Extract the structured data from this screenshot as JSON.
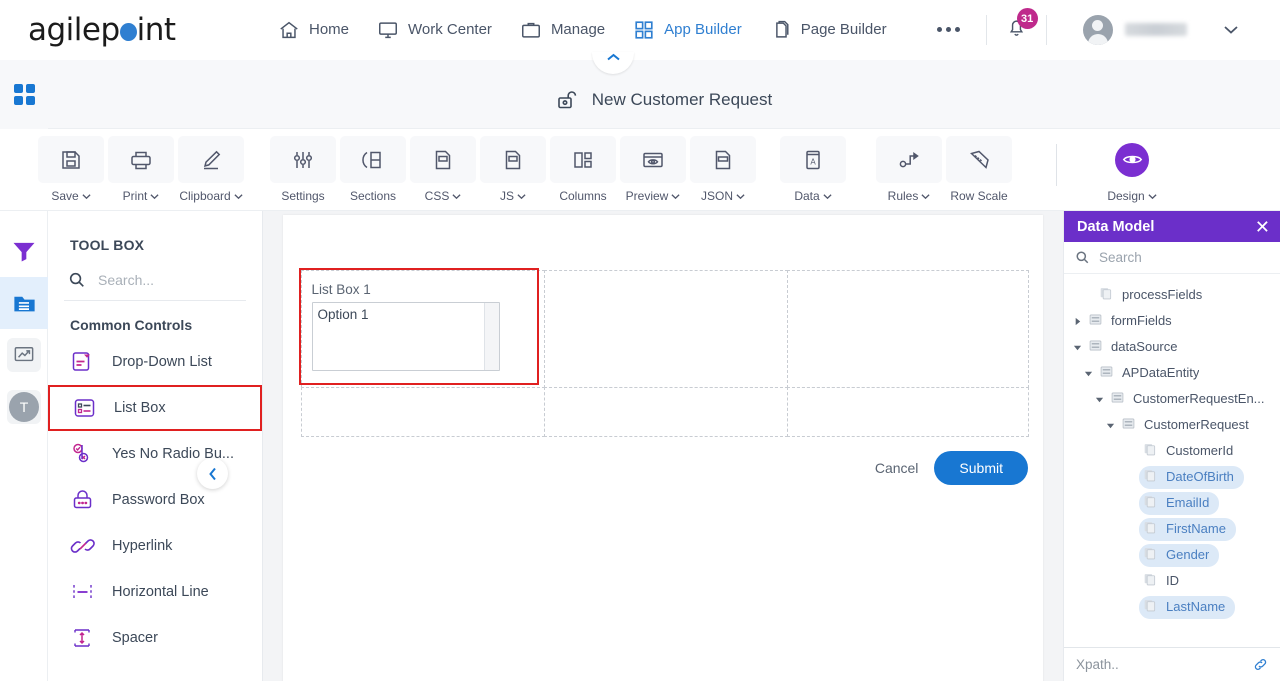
{
  "brand": {
    "name_prefix": "agilep",
    "name_suffix": "int",
    "dot_color": "#2f7fd1"
  },
  "topnav": {
    "items": [
      {
        "label": "Home",
        "icon": "home-icon",
        "active": false
      },
      {
        "label": "Work Center",
        "icon": "monitor-icon",
        "active": false
      },
      {
        "label": "Manage",
        "icon": "briefcase-icon",
        "active": false
      },
      {
        "label": "App Builder",
        "icon": "grid-icon",
        "active": true
      },
      {
        "label": "Page Builder",
        "icon": "pages-icon",
        "active": false
      }
    ],
    "more_label": "",
    "notification_count": "31",
    "username": "",
    "accent_blue": "#2f7fd1",
    "badge_color": "#bf2a8c"
  },
  "form_header": {
    "title": "New Customer Request",
    "lock_icon": "unlock-icon",
    "collapse_icon": "chevron-up-icon"
  },
  "toolbar": {
    "buttons": [
      {
        "label": "Save",
        "icon": "save-icon",
        "caret": true
      },
      {
        "label": "Print",
        "icon": "print-icon",
        "caret": true
      },
      {
        "label": "Clipboard",
        "icon": "pencil-icon",
        "caret": true
      },
      {
        "label": "Settings",
        "icon": "sliders-icon",
        "caret": false
      },
      {
        "label": "Sections",
        "icon": "sections-icon",
        "caret": false
      },
      {
        "label": "CSS",
        "icon": "css-file-icon",
        "caret": true
      },
      {
        "label": "JS",
        "icon": "js-file-icon",
        "caret": true
      },
      {
        "label": "Columns",
        "icon": "columns-icon",
        "caret": false
      },
      {
        "label": "Preview",
        "icon": "eye-window-icon",
        "caret": true
      },
      {
        "label": "JSON",
        "icon": "json-file-icon",
        "caret": true
      },
      {
        "label": "Data",
        "icon": "data-book-icon",
        "caret": true
      },
      {
        "label": "Rules",
        "icon": "rules-icon",
        "caret": true
      },
      {
        "label": "Row Scale",
        "icon": "ruler-icon",
        "caret": false
      }
    ],
    "design": {
      "label": "Design",
      "icon": "eye-icon",
      "caret": true,
      "color": "#7b2fd1"
    }
  },
  "rail": {
    "items": [
      {
        "name": "filter-icon",
        "active": false
      },
      {
        "name": "toolbox-folder-icon",
        "active": true
      },
      {
        "name": "analytics-icon",
        "active": false
      },
      {
        "name": "theme-t-icon",
        "active": false,
        "letter": "T"
      }
    ]
  },
  "toolbox": {
    "title": "TOOL BOX",
    "search_placeholder": "Search...",
    "search_value": "",
    "group_label": "Common Controls",
    "items": [
      {
        "label": "Drop-Down List",
        "icon": "drop-down-list-icon",
        "selected": false
      },
      {
        "label": "List Box",
        "icon": "list-box-icon",
        "selected": true
      },
      {
        "label": "Yes No Radio Bu...",
        "icon": "yes-no-radio-icon",
        "selected": false
      },
      {
        "label": "Password Box",
        "icon": "password-box-icon",
        "selected": false
      },
      {
        "label": "Hyperlink",
        "icon": "hyperlink-icon",
        "selected": false
      },
      {
        "label": "Horizontal Line",
        "icon": "horizontal-line-icon",
        "selected": false
      },
      {
        "label": "Spacer",
        "icon": "spacer-icon",
        "selected": false
      }
    ],
    "collapse_icon": "chevron-left-icon"
  },
  "canvas": {
    "control": {
      "label": "List Box 1",
      "option": "Option 1",
      "selected": true,
      "highlight_color": "#e02020"
    },
    "cancel_label": "Cancel",
    "submit_label": "Submit",
    "submit_color": "#1877d2"
  },
  "data_model": {
    "title": "Data Model",
    "close_icon": "close-icon",
    "search_placeholder": "Search",
    "search_value": "",
    "header_color": "#6b2fc9",
    "tree": [
      {
        "label": "processFields",
        "depth": 1,
        "twisty": "none",
        "icon": "field-icon",
        "highlight": false
      },
      {
        "label": "formFields",
        "depth": 0,
        "twisty": "collapsed",
        "icon": "entity-icon",
        "highlight": false
      },
      {
        "label": "dataSource",
        "depth": 0,
        "twisty": "expanded",
        "icon": "entity-icon",
        "highlight": false
      },
      {
        "label": "APDataEntity",
        "depth": 1,
        "twisty": "expanded",
        "icon": "entity-icon",
        "highlight": false
      },
      {
        "label": "CustomerRequestEn...",
        "depth": 2,
        "twisty": "expanded",
        "icon": "entity-icon",
        "highlight": false
      },
      {
        "label": "CustomerRequest",
        "depth": 3,
        "twisty": "expanded",
        "icon": "entity-icon",
        "highlight": false
      },
      {
        "label": "CustomerId",
        "depth": 5,
        "twisty": "none",
        "icon": "field-icon",
        "highlight": false
      },
      {
        "label": "DateOfBirth",
        "depth": 5,
        "twisty": "none",
        "icon": "field-icon",
        "highlight": true
      },
      {
        "label": "EmailId",
        "depth": 5,
        "twisty": "none",
        "icon": "field-icon",
        "highlight": true
      },
      {
        "label": "FirstName",
        "depth": 5,
        "twisty": "none",
        "icon": "field-icon",
        "highlight": true
      },
      {
        "label": "Gender",
        "depth": 5,
        "twisty": "none",
        "icon": "field-icon",
        "highlight": true
      },
      {
        "label": "ID",
        "depth": 5,
        "twisty": "none",
        "icon": "field-icon",
        "highlight": false
      },
      {
        "label": "LastName",
        "depth": 5,
        "twisty": "none",
        "icon": "field-icon",
        "highlight": true
      }
    ],
    "xpath_placeholder": "Xpath..",
    "xpath_value": "",
    "link_icon": "link-icon"
  }
}
